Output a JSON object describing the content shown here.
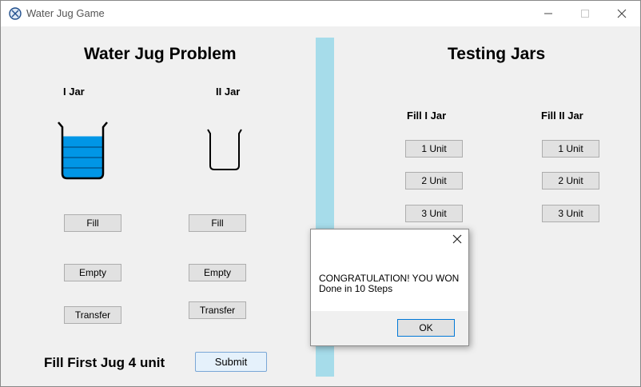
{
  "window": {
    "title": "Water Jug Game"
  },
  "left": {
    "heading": "Water Jug Problem",
    "jar1_label": "I Jar",
    "jar2_label": "II Jar",
    "jar1_buttons": {
      "fill": "Fill",
      "empty": "Empty",
      "transfer": "Transfer"
    },
    "jar2_buttons": {
      "fill": "Fill",
      "empty": "Empty",
      "transfer": "Transfer"
    },
    "goal": "Fill First Jug 4 unit",
    "submit": "Submit",
    "jar1_level_fraction": 0.75,
    "jar2_level_fraction": 0,
    "water_color": "#0096e6"
  },
  "right": {
    "heading": "Testing Jars",
    "fill1_label": "Fill I Jar",
    "fill2_label": "Fill II Jar",
    "fill1_buttons": [
      "1 Unit",
      "2 Unit",
      "3 Unit"
    ],
    "fill2_buttons": [
      "1 Unit",
      "2 Unit",
      "3 Unit"
    ]
  },
  "dialog": {
    "line1": "CONGRATULATION! YOU WON",
    "line2": "Done in 10 Steps",
    "ok": "OK"
  }
}
